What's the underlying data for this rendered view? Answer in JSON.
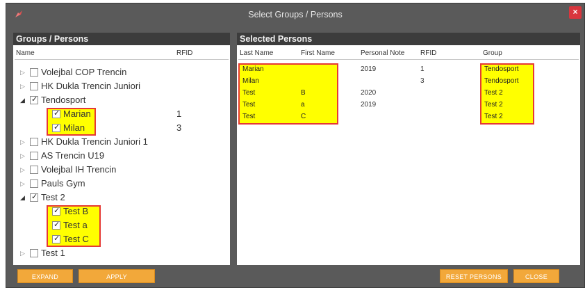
{
  "window": {
    "title": "Select Groups / Persons",
    "close_glyph": "×"
  },
  "left_panel": {
    "header": "Groups / Persons",
    "col_name": "Name",
    "col_rfid": "RFID",
    "rows": [
      {
        "label": "Volejbal COP Trencin",
        "rfid": "",
        "checked": false,
        "expanded": false
      },
      {
        "label": "HK Dukla Trencin Juniori",
        "rfid": "",
        "checked": false,
        "expanded": false
      },
      {
        "label": "Tendosport",
        "rfid": "",
        "checked": true,
        "expanded": true
      },
      {
        "label": "Marian",
        "rfid": "1",
        "checked": true,
        "child": true
      },
      {
        "label": "Milan",
        "rfid": "3",
        "checked": true,
        "child": true
      },
      {
        "label": "HK Dukla Trencin Juniori 1",
        "rfid": "",
        "checked": false,
        "expanded": false
      },
      {
        "label": "AS Trencin U19",
        "rfid": "",
        "checked": false,
        "expanded": false
      },
      {
        "label": "Volejbal IH Trencin",
        "rfid": "",
        "checked": false,
        "expanded": false
      },
      {
        "label": "Pauls Gym",
        "rfid": "",
        "checked": false,
        "expanded": false
      },
      {
        "label": "Test 2",
        "rfid": "",
        "checked": true,
        "expanded": true
      },
      {
        "label": "Test B",
        "rfid": "",
        "checked": true,
        "child": true
      },
      {
        "label": "Test a",
        "rfid": "",
        "checked": true,
        "child": true
      },
      {
        "label": "Test  C",
        "rfid": "",
        "checked": true,
        "child": true
      },
      {
        "label": "Test 1",
        "rfid": "",
        "checked": false,
        "expanded": false
      }
    ]
  },
  "right_panel": {
    "header": "Selected Persons",
    "columns": [
      "Last Name",
      "First Name",
      "Personal Note",
      "RFID",
      "Group"
    ],
    "rows": [
      {
        "last": "Marian",
        "first": "",
        "note": "2019",
        "rfid": "1",
        "group": "Tendosport"
      },
      {
        "last": "Milan",
        "first": "",
        "note": "",
        "rfid": "3",
        "group": "Tendosport"
      },
      {
        "last": "Test",
        "first": "B",
        "note": "2020",
        "rfid": "",
        "group": "Test 2"
      },
      {
        "last": "Test",
        "first": "a",
        "note": "2019",
        "rfid": "",
        "group": "Test 2"
      },
      {
        "last": "Test",
        "first": "C",
        "note": "",
        "rfid": "",
        "group": "Test 2"
      }
    ]
  },
  "buttons": {
    "expand": "EXPAND",
    "apply": "APPLY",
    "reset": "RESET PERSONS",
    "close": "CLOSE"
  },
  "colors": {
    "highlight": "#ffff00",
    "highlight_border": "#e53935",
    "button": "#f2a83a",
    "header": "#3c3c3c",
    "window": "#5a5a5a"
  }
}
